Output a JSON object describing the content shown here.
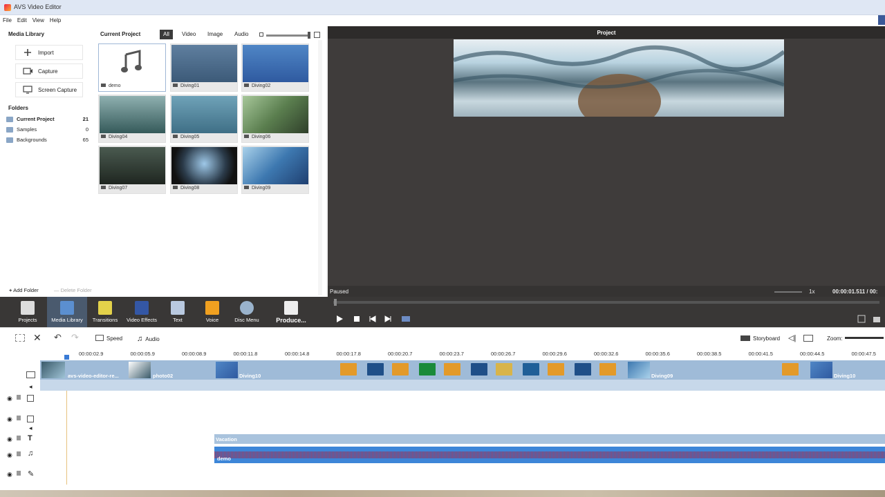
{
  "window": {
    "title": "AVS Video Editor"
  },
  "menu": [
    "File",
    "Edit",
    "View",
    "Help"
  ],
  "library": {
    "title": "Media Library",
    "buttons": [
      "Import",
      "Capture",
      "Screen Capture"
    ],
    "folders_title": "Folders",
    "folders": [
      {
        "name": "Current Project",
        "count": "21"
      },
      {
        "name": "Samples",
        "count": "0"
      },
      {
        "name": "Backgrounds",
        "count": "65"
      }
    ],
    "add_folder": "Add Folder",
    "delete_folder": "Delete Folder"
  },
  "grid": {
    "title": "Current Project",
    "filters": [
      "All",
      "Video",
      "Image",
      "Audio"
    ],
    "items": [
      "demo",
      "Diving01",
      "Diving02",
      "Diving04",
      "Diving05",
      "Diving06",
      "Diving07",
      "Diving08",
      "Diving09"
    ]
  },
  "preview": {
    "title": "Project",
    "status": "Paused",
    "speed": "1x",
    "time": "00:00:01.511 / 00:"
  },
  "toolbar": [
    "Projects",
    "Media Library",
    "Transitions",
    "Video Effects",
    "Text",
    "Voice",
    "Disc Menu",
    "Produce..."
  ],
  "timeline": {
    "speed": "Speed",
    "audio": "Audio",
    "storyboard": "Storyboard",
    "zoom": "Zoom:",
    "ticks": [
      "00:00:02.9",
      "00:00:05.9",
      "00:00:08.9",
      "00:00:11.8",
      "00:00:14.8",
      "00:00:17.8",
      "00:00:20.7",
      "00:00:23.7",
      "00:00:26.7",
      "00:00:29.6",
      "00:00:32.6",
      "00:00:35.6",
      "00:00:38.5",
      "00:00:41.5",
      "00:00:44.5",
      "00:00:47.5"
    ],
    "clips": [
      "avs-video-editor-re...",
      "photo02",
      "Diving10",
      "Diving09",
      "Diving10"
    ],
    "text_clip": "Vacation",
    "audio_clip": "demo"
  },
  "colors": {
    "accent": "#3b6ea5",
    "dark_panel": "#393736",
    "clip_blue": "#9fbbd8"
  }
}
